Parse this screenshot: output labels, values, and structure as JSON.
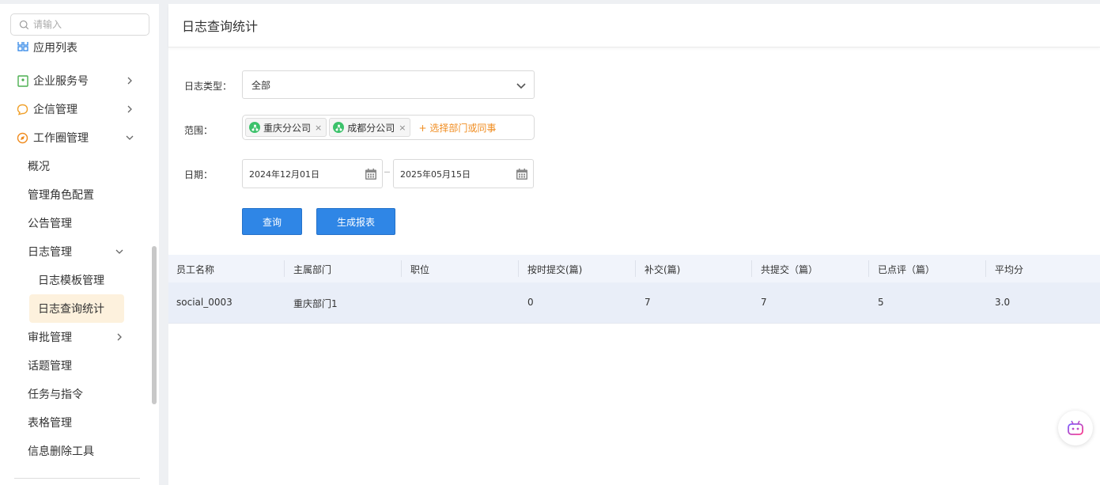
{
  "sidebar": {
    "search_placeholder": "请输入",
    "items": [
      {
        "label": "应用列表"
      },
      {
        "label": "企业服务号"
      },
      {
        "label": "企信管理"
      },
      {
        "label": "工作圈管理"
      },
      {
        "label": "概况"
      },
      {
        "label": "管理角色配置"
      },
      {
        "label": "公告管理"
      },
      {
        "label": "日志管理"
      },
      {
        "label": "日志模板管理"
      },
      {
        "label": "日志查询统计"
      },
      {
        "label": "审批管理"
      },
      {
        "label": "话题管理"
      },
      {
        "label": "任务与指令"
      },
      {
        "label": "表格管理"
      },
      {
        "label": "信息删除工具"
      }
    ]
  },
  "header": {
    "title": "日志查询统计"
  },
  "form": {
    "log_type_label": "日志类型：",
    "log_type_value": "全部",
    "scope_label": "范围：",
    "scope_tags": [
      "重庆分公司",
      "成都分公司"
    ],
    "scope_tag_remove": "×",
    "scope_add": "+ 选择部门或同事",
    "date_label": "日期：",
    "date_start": "2024年12月01日",
    "date_end": "2025年05月15日",
    "query_button": "查询",
    "report_button": "生成报表"
  },
  "table": {
    "columns": [
      "员工名称",
      "主属部门",
      "职位",
      "按时提交(篇)",
      "补交(篇)",
      "共提交（篇）",
      "已点评（篇）",
      "平均分"
    ],
    "rows": [
      [
        "social_0003",
        "重庆部门1",
        "",
        "0",
        "7",
        "7",
        "5",
        "3.0"
      ]
    ]
  },
  "colors": {
    "primary_button": "#2f86e6",
    "active_nav_bg": "#fdf1dd",
    "add_link": "#f08c1f",
    "org_tag_icon": "#3cc26b"
  }
}
